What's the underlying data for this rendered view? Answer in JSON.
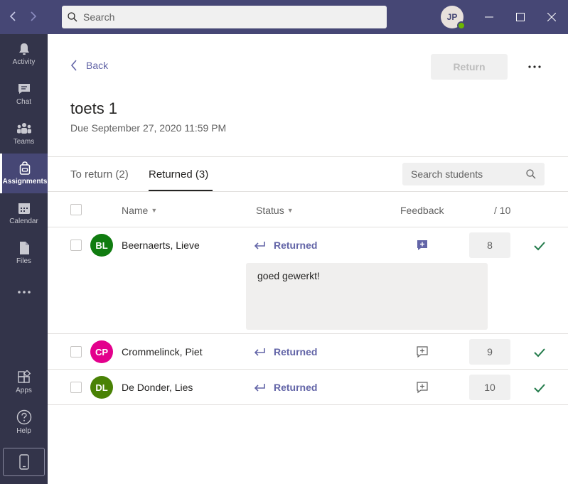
{
  "header": {
    "search_placeholder": "Search",
    "avatar_initials": "JP"
  },
  "rail": {
    "items": [
      {
        "label": "Activity",
        "icon": "bell-icon"
      },
      {
        "label": "Chat",
        "icon": "chat-icon"
      },
      {
        "label": "Teams",
        "icon": "teams-icon"
      },
      {
        "label": "Assignments",
        "icon": "assignments-icon",
        "active": true
      },
      {
        "label": "Calendar",
        "icon": "calendar-icon"
      },
      {
        "label": "Files",
        "icon": "files-icon"
      },
      {
        "label": "Apps",
        "icon": "apps-icon"
      },
      {
        "label": "Help",
        "icon": "help-icon"
      }
    ]
  },
  "assignment": {
    "back_label": "Back",
    "return_label": "Return",
    "title": "toets 1",
    "due": "Due September 27, 2020 11:59 PM"
  },
  "tabs": {
    "to_return": "To return (2)",
    "returned": "Returned (3)"
  },
  "student_search_placeholder": "Search students",
  "columns": {
    "name": "Name",
    "status": "Status",
    "feedback": "Feedback",
    "points": "/ 10"
  },
  "students": [
    {
      "initials": "BL",
      "name": "Beernaerts, Lieve",
      "status": "Returned",
      "grade": "8",
      "avatar_color": "#107c10",
      "feedback": "goed gewerkt!"
    },
    {
      "initials": "CP",
      "name": "Crommelinck, Piet",
      "status": "Returned",
      "grade": "9",
      "avatar_color": "#e3008c"
    },
    {
      "initials": "DL",
      "name": "De Donder, Lies",
      "status": "Returned",
      "grade": "10",
      "avatar_color": "#498205"
    }
  ],
  "colors": {
    "accent": "#6264a7",
    "titlebar": "#464775",
    "rail": "#33344a",
    "check": "#237b4b"
  }
}
